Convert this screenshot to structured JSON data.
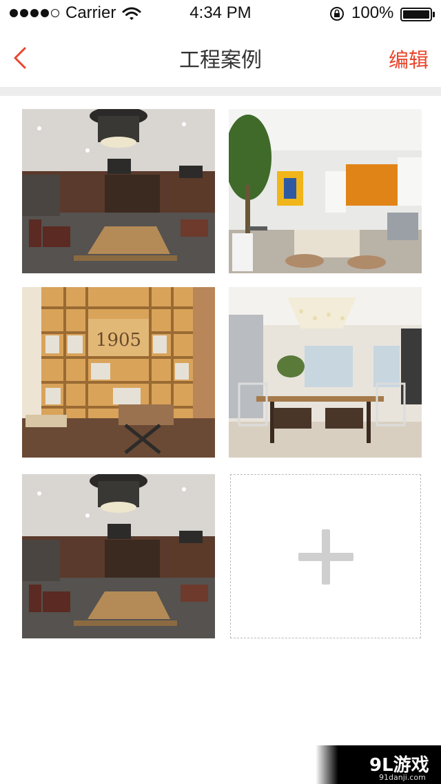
{
  "status_bar": {
    "carrier": "Carrier",
    "time": "4:34 PM",
    "battery": "100%"
  },
  "nav": {
    "title": "工程案例",
    "edit_label": "编辑"
  },
  "photos": [
    {
      "scene": "restaurant-interior"
    },
    {
      "scene": "living-room"
    },
    {
      "scene": "bookshelf-cafe"
    },
    {
      "scene": "dining-room"
    },
    {
      "scene": "restaurant-interior"
    }
  ],
  "watermark": {
    "logo": "9L游戏",
    "url": "91danji.com"
  },
  "colors": {
    "accent": "#e8452c",
    "divider": "#ededed",
    "add_border": "#b9b9b9",
    "plus": "#cfcfcf"
  }
}
